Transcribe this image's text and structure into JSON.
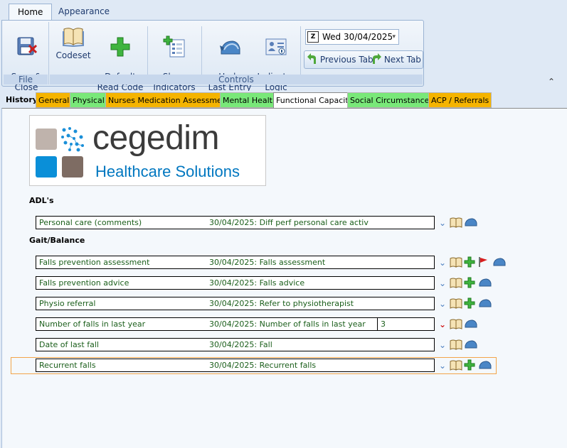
{
  "ribbon": {
    "tabs": [
      {
        "label": "Home"
      },
      {
        "label": "Appearance"
      }
    ],
    "buttons": {
      "save_close": "Save &\nClose",
      "codeset": "Codeset",
      "default_read_code": "Default\nRead Code",
      "show_indicators": "Show\nIndicators",
      "undo_last_entry": "Undo\nLast Entry",
      "indicator_logic": "Indicator\nLogic"
    },
    "groups": {
      "file": "File",
      "controls": "Controls"
    },
    "date": "Wed 30/04/2025",
    "calendar_glyph": "Z",
    "previous_tab": "Previous Tab",
    "next_tab": "Next Tab",
    "colors": {
      "accent": "#1e3a6e",
      "green": "#2e9e2e"
    }
  },
  "content_tabs": [
    {
      "label": "History",
      "color": "#dfe9f5"
    },
    {
      "label": "General",
      "color": "#f5b400"
    },
    {
      "label": "Physical",
      "color": "#79e879"
    },
    {
      "label": "Nurses Medication Assessment",
      "color": "#f5b400"
    },
    {
      "label": "Mental Health",
      "color": "#79e879"
    },
    {
      "label": "Functional Capacity",
      "color": "#ffffff"
    },
    {
      "label": "Social Circumstances",
      "color": "#79e879"
    },
    {
      "label": "ACP / Referrals",
      "color": "#f5b400"
    }
  ],
  "logo": {
    "word": "cegedim",
    "sub": "Healthcare Solutions"
  },
  "sections": {
    "adls": "ADL's",
    "gait": "Gait/Balance"
  },
  "rows": [
    {
      "label": "Personal care (comments)",
      "value": "30/04/2025: Diff perf personal care activ",
      "extra": "",
      "icons": [
        "chevron-icon",
        "book-icon",
        "undo-icon"
      ]
    },
    {
      "label": "Falls prevention assessment",
      "value": "30/04/2025: Falls assessment",
      "extra": "",
      "icons": [
        "chevron-icon",
        "book-icon",
        "add-icon",
        "flag-icon",
        "undo-icon"
      ]
    },
    {
      "label": "Falls prevention advice",
      "value": "30/04/2025: Falls advice",
      "extra": "",
      "icons": [
        "chevron-icon",
        "book-icon",
        "add-icon",
        "undo-icon"
      ]
    },
    {
      "label": "Physio referral",
      "value": "30/04/2025: Refer to physiotherapist",
      "extra": "",
      "icons": [
        "chevron-icon",
        "book-icon",
        "add-icon",
        "undo-icon"
      ]
    },
    {
      "label": "Number of falls in last year",
      "value": "30/04/2025: Number of falls in last year",
      "extra": "3",
      "icons": [
        "chevron-red-icon",
        "book-icon",
        "undo-icon"
      ]
    },
    {
      "label": "Date of last fall",
      "value": "30/04/2025: Fall",
      "extra": "",
      "icons": [
        "chevron-icon",
        "book-icon",
        "undo-icon"
      ]
    },
    {
      "label": "Recurrent falls",
      "value": "30/04/2025: Recurrent falls",
      "extra": "",
      "icons": [
        "chevron-icon",
        "book-icon",
        "add-icon",
        "undo-icon"
      ]
    }
  ]
}
